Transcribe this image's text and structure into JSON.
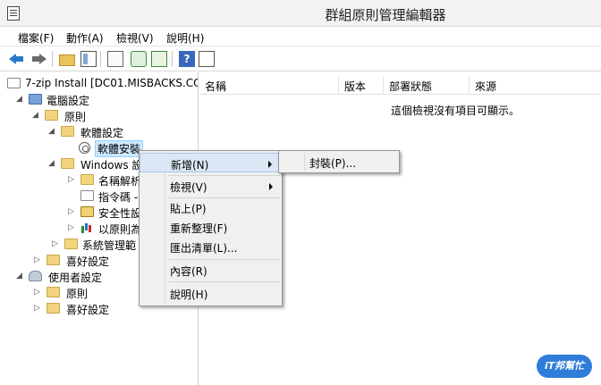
{
  "window": {
    "title": "群組原則管理編輯器"
  },
  "menubar": {
    "items": [
      "檔案(F)",
      "動作(A)",
      "檢視(V)",
      "說明(H)"
    ]
  },
  "toolbar": {
    "help_label": "?"
  },
  "tree": {
    "nodes": [
      {
        "label": "7-zip Install [DC01.MISBACKS.CO",
        "icon": "gpo-icon"
      },
      {
        "label": "電腦設定",
        "icon": "computer-icon"
      },
      {
        "label": "原則",
        "icon": "folder-icon"
      },
      {
        "label": "軟體設定",
        "icon": "folder-icon"
      },
      {
        "label": "軟體安裝",
        "icon": "software-install-icon"
      },
      {
        "label": "Windows 設",
        "icon": "folder-icon"
      },
      {
        "label": "名稱解析",
        "icon": "folder-icon"
      },
      {
        "label": "指令碼 -",
        "icon": "script-icon"
      },
      {
        "label": "安全性設",
        "icon": "security-icon"
      },
      {
        "label": "以原則為",
        "icon": "chart-icon"
      },
      {
        "label": "系統管理範",
        "icon": "folder-icon"
      },
      {
        "label": "喜好設定",
        "icon": "folder-icon"
      },
      {
        "label": "使用者設定",
        "icon": "user-icon"
      },
      {
        "label": "原則",
        "icon": "folder-icon"
      },
      {
        "label": "喜好設定",
        "icon": "folder-icon"
      }
    ]
  },
  "list": {
    "columns": [
      "名稱",
      "版本",
      "部署狀態",
      "來源"
    ],
    "empty_message": "這個檢視沒有項目可顯示。"
  },
  "context_menu": {
    "items": [
      "新增(N)",
      "檢視(V)",
      "貼上(P)",
      "重新整理(F)",
      "匯出清單(L)...",
      "內容(R)",
      "說明(H)"
    ],
    "submenu": [
      "封裝(P)..."
    ]
  },
  "watermark": {
    "text": "iT邦幫忙"
  }
}
